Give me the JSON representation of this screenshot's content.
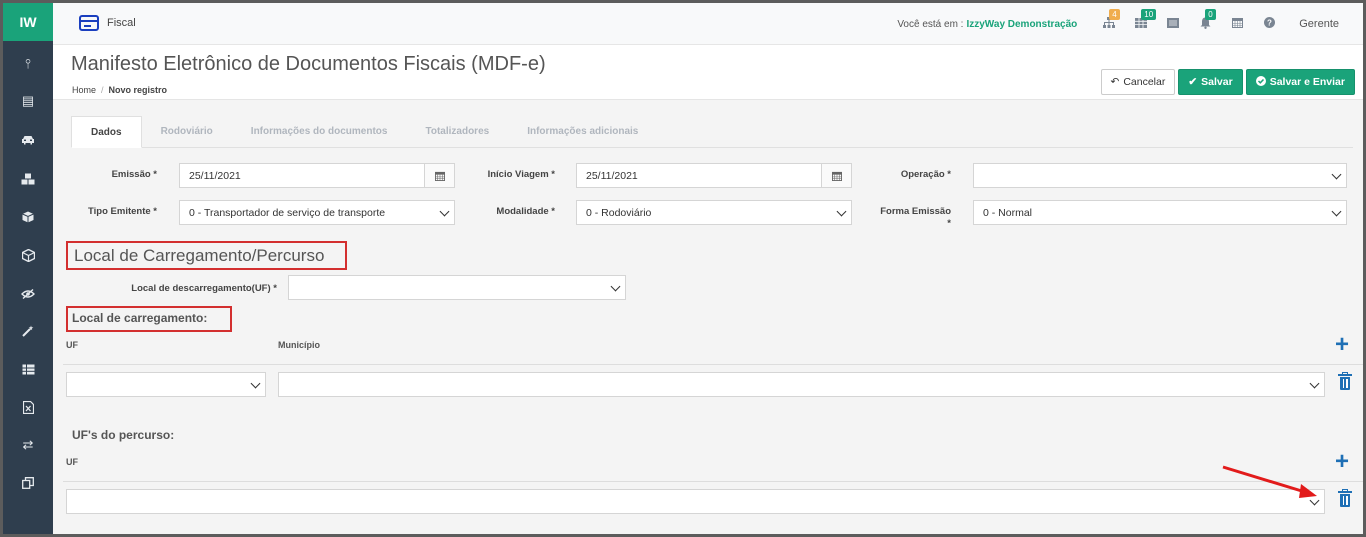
{
  "app": {
    "logo": "IW"
  },
  "sidebar": {
    "icons": [
      "pin-icon",
      "list-icon",
      "car-icon",
      "boxes-icon",
      "cube-icon",
      "cubes-icon",
      "eye-slash-icon",
      "magic-wand-icon",
      "table-icon",
      "excel-file-icon",
      "exchange-icon",
      "copy-icon"
    ]
  },
  "topbar": {
    "module": "Fiscal",
    "location_label": "Você está em :",
    "company": "IzzyWay Demonstração",
    "badges": {
      "sitemap": "4",
      "grid": "10",
      "bell": "0"
    },
    "user": "Gerente"
  },
  "header": {
    "title": "Manifesto Eletrônico de Documentos Fiscais (MDF-e)",
    "breadcrumb": {
      "home": "Home",
      "separator": "/",
      "current": "Novo registro"
    },
    "buttons": {
      "cancel": "Cancelar",
      "save": "Salvar",
      "save_send": "Salvar e Enviar"
    }
  },
  "tabs": [
    "Dados",
    "Rodoviário",
    "Informações do documentos",
    "Totalizadores",
    "Informações adicionais"
  ],
  "form": {
    "emissao": {
      "label": "Emissão *",
      "value": "25/11/2021"
    },
    "inicio_viagem": {
      "label": "Início Viagem *",
      "value": "25/11/2021"
    },
    "operacao": {
      "label": "Operação *",
      "value": ""
    },
    "tipo_emitente": {
      "label": "Tipo Emitente *",
      "value": "0 - Transportador de serviço de transporte"
    },
    "modalidade": {
      "label": "Modalidade *",
      "value": "0 - Rodoviário"
    },
    "forma_emissao": {
      "label": "Forma Emissão",
      "required": "*",
      "value": "0 - Normal"
    }
  },
  "section": {
    "title": "Local de Carregamento/Percurso",
    "descarregamento_label": "Local de descarregamento(UF) *",
    "carregamento": {
      "title": "Local de carregamento:",
      "col_uf": "UF",
      "col_municipio": "Município"
    },
    "percurso": {
      "title": "UF's do percurso:",
      "col_uf": "UF"
    }
  },
  "colors": {
    "accent": "#1aa37a",
    "sidebar": "#2f3e4e",
    "highlight": "#d32f2f",
    "action_blue": "#1e6fb5"
  }
}
